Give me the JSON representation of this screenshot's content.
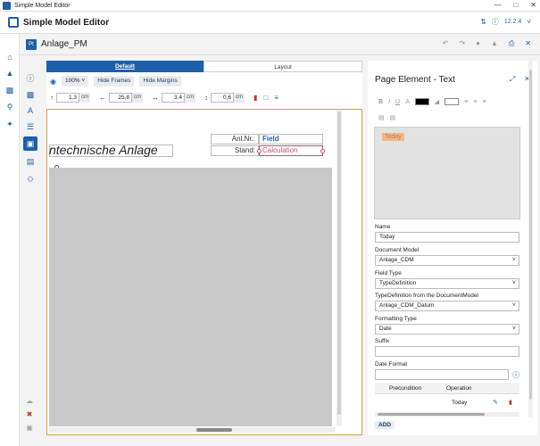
{
  "window": {
    "title": "Simple Model Editor"
  },
  "app": {
    "title": "Simple Model Editor",
    "version": "12.2.4"
  },
  "document": {
    "badge": "Pt",
    "title": "Anlage_PM"
  },
  "editor": {
    "tabs": [
      {
        "label": "Default",
        "active": true
      },
      {
        "label": "Layout",
        "active": false
      }
    ],
    "zoom": "100%",
    "hide_frames": "Hide Frames",
    "hide_margins": "Hide Margins",
    "dims": [
      {
        "value": "1,3",
        "unit": "cm"
      },
      {
        "value": "25,8",
        "unit": "cm"
      },
      {
        "value": "3,4",
        "unit": "cm"
      },
      {
        "value": "0,6",
        "unit": "cm"
      }
    ],
    "canvas": {
      "heading": "ntechnische Anlage",
      "anl_label": "Anl.Nr.:",
      "anl_value": "Field",
      "stand_label": "Stand:",
      "stand_value": "Calculation"
    }
  },
  "panel": {
    "title": "Page Element - Text",
    "preview_tag": "Today",
    "name_label": "Name",
    "name_value": "Today",
    "doc_model_label": "Document Model",
    "doc_model_value": "Anlage_CDM",
    "field_type_label": "Field Type",
    "field_type_value": "TypeDefinition",
    "typedef_label": "TypeDefinition from the DocumentModel",
    "typedef_value": "Anlage_CDM_Datum",
    "fmt_type_label": "Formatting Type",
    "fmt_type_value": "Date",
    "suffix_label": "Suffix",
    "suffix_value": "",
    "date_format_label": "Date Format",
    "date_format_value": "",
    "table": {
      "col_precondition": "Precondition",
      "col_operation": "Operation",
      "rows": [
        {
          "precondition": "",
          "operation": "Today"
        }
      ]
    },
    "add_label": "ADD"
  },
  "colors": {
    "accent": "#1d5fa8",
    "highlight": "#c0507a",
    "frame": "#d9a03a"
  }
}
